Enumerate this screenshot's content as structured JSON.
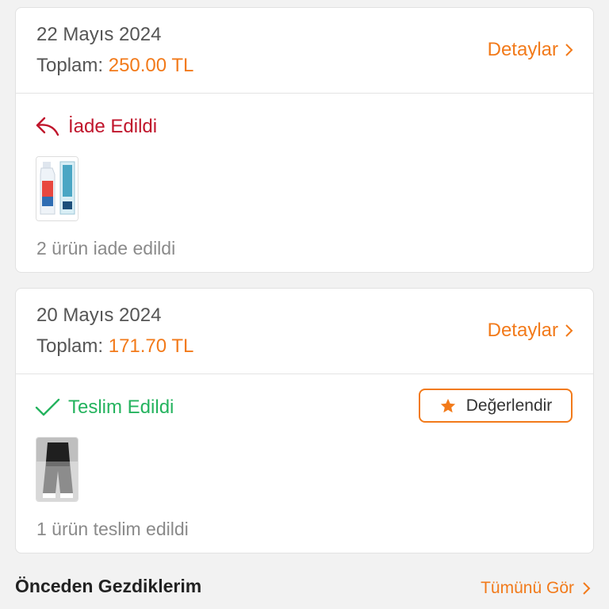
{
  "orders": [
    {
      "date": "22 Mayıs 2024",
      "total_label": "Toplam:",
      "total_amount": "250.00 TL",
      "details_label": "Detaylar",
      "status": "İade Edildi",
      "summary": "2 ürün iade edildi",
      "status_color": "#c0152c",
      "status_icon": "return-arrow-icon"
    },
    {
      "date": "20 Mayıs 2024",
      "total_label": "Toplam:",
      "total_amount": "171.70 TL",
      "details_label": "Detaylar",
      "status": "Teslim Edildi",
      "summary": "1 ürün teslim edildi",
      "status_color": "#24b35e",
      "status_icon": "checkmark-icon",
      "rate_label": "Değerlendir"
    }
  ],
  "recently_viewed": {
    "title": "Önceden Gezdiklerim",
    "see_all_label": "Tümünü Gör"
  },
  "colors": {
    "accent": "#f27a1a",
    "text": "#555555",
    "muted": "#8a8a8a"
  }
}
